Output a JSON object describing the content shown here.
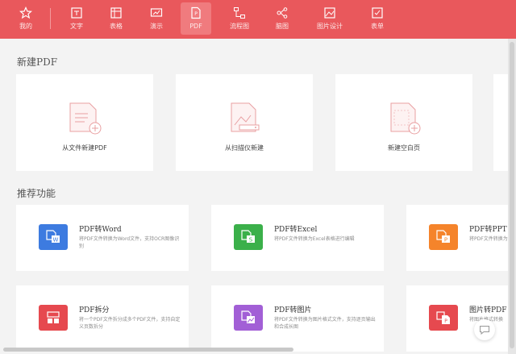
{
  "toolbar": {
    "items": [
      {
        "label": "我的",
        "icon": "star-icon"
      },
      {
        "label": "文字",
        "icon": "writer-doc-icon"
      },
      {
        "label": "表格",
        "icon": "spreadsheet-icon"
      },
      {
        "label": "演示",
        "icon": "presentation-icon"
      },
      {
        "label": "PDF",
        "icon": "pdf-icon",
        "active": true
      },
      {
        "label": "流程图",
        "icon": "flowchart-icon"
      },
      {
        "label": "脑图",
        "icon": "mindmap-icon"
      },
      {
        "label": "图片设计",
        "icon": "image-design-icon"
      },
      {
        "label": "表单",
        "icon": "form-icon"
      }
    ]
  },
  "new_pdf": {
    "title": "新建PDF",
    "cards": [
      {
        "label": "从文件新建PDF"
      },
      {
        "label": "从扫描仪新建"
      },
      {
        "label": "新建空白页"
      }
    ]
  },
  "recommend": {
    "title": "推荐功能",
    "cards": [
      {
        "title": "PDF转Word",
        "desc": "将PDF文件转换为Word文件，支持OCR图像识别",
        "color": "#3d7be0"
      },
      {
        "title": "PDF转Excel",
        "desc": "将PDF文件转换为Excel表格进行编辑",
        "color": "#3bb04a"
      },
      {
        "title": "PDF转PPT",
        "desc": "将PDF文件转换为",
        "color": "#f5842b"
      },
      {
        "title": "PDF拆分",
        "desc": "将一个PDF文件拆分成多个PDF文件，支持自定义页数拆分",
        "color": "#e6494f"
      },
      {
        "title": "PDF转图片",
        "desc": "将PDF文件转换为图片格式文件，支持逐页输出和合成长图",
        "color": "#a25fd6"
      },
      {
        "title": "图片转PDF",
        "desc": "将图片格式转换",
        "color": "#e6494f"
      }
    ]
  },
  "colors": {
    "toolbar_bg": "#e9585c",
    "accent": "#e9585c"
  }
}
